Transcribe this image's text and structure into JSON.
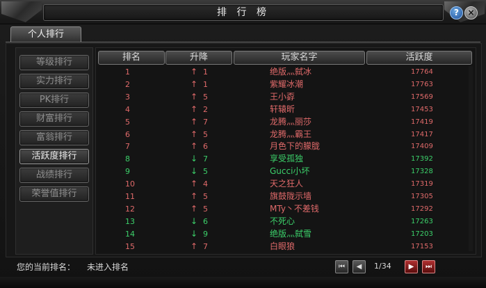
{
  "window": {
    "title": "排 行 榜"
  },
  "tab": {
    "label": "个人排行"
  },
  "categories": [
    {
      "label": "等级排行"
    },
    {
      "label": "实力排行"
    },
    {
      "label": "PK排行"
    },
    {
      "label": "财富排行"
    },
    {
      "label": "富翁排行"
    },
    {
      "label": "活跃度排行"
    },
    {
      "label": "战绩排行"
    },
    {
      "label": "荣誉值排行"
    }
  ],
  "active_category": "活跃度排行",
  "table": {
    "headers": {
      "rank": "排名",
      "change": "升降",
      "name": "玩家名字",
      "activity": "活跃度"
    },
    "rows": [
      {
        "rank": "1",
        "dir": "up",
        "arrow": "↑",
        "change": "1",
        "name": "绝版灬弑冰",
        "activity": "17764"
      },
      {
        "rank": "2",
        "dir": "up",
        "arrow": "↑",
        "change": "1",
        "name": "紫耀冰潮",
        "activity": "17763"
      },
      {
        "rank": "3",
        "dir": "up",
        "arrow": "↑",
        "change": "5",
        "name": "王小孬",
        "activity": "17569"
      },
      {
        "rank": "4",
        "dir": "up",
        "arrow": "↑",
        "change": "2",
        "name": "轩辕昕",
        "activity": "17453"
      },
      {
        "rank": "5",
        "dir": "up",
        "arrow": "↑",
        "change": "7",
        "name": "龙腾灬丽莎",
        "activity": "17419"
      },
      {
        "rank": "6",
        "dir": "up",
        "arrow": "↑",
        "change": "5",
        "name": "龙腾灬霸王",
        "activity": "17417"
      },
      {
        "rank": "7",
        "dir": "up",
        "arrow": "↑",
        "change": "6",
        "name": "月色下的朦胧",
        "activity": "17409"
      },
      {
        "rank": "8",
        "dir": "down",
        "arrow": "↓",
        "change": "7",
        "name": "享受孤独",
        "activity": "17392"
      },
      {
        "rank": "9",
        "dir": "down",
        "arrow": "↓",
        "change": "5",
        "name": "Gucci小坏",
        "activity": "17328"
      },
      {
        "rank": "10",
        "dir": "up",
        "arrow": "↑",
        "change": "4",
        "name": "天之狂人",
        "activity": "17319"
      },
      {
        "rank": "11",
        "dir": "up",
        "arrow": "↑",
        "change": "5",
        "name": "旗鼓陇示墙",
        "activity": "17305"
      },
      {
        "rank": "12",
        "dir": "up",
        "arrow": "↑",
        "change": "5",
        "name": "MTy丶不差钱",
        "activity": "17292"
      },
      {
        "rank": "13",
        "dir": "down",
        "arrow": "↓",
        "change": "6",
        "name": "不死心",
        "activity": "17263"
      },
      {
        "rank": "14",
        "dir": "down",
        "arrow": "↓",
        "change": "9",
        "name": "绝版灬弑雪",
        "activity": "17203"
      },
      {
        "rank": "15",
        "dir": "up",
        "arrow": "↑",
        "change": "7",
        "name": "白眼狼",
        "activity": "17153"
      }
    ]
  },
  "footer": {
    "label": "您的当前排名：",
    "value": "未进入排名",
    "page": "1/34"
  },
  "icons": {
    "help": "?",
    "close": "×",
    "first": "⏮",
    "prev": "◀",
    "next": "▶",
    "last": "⏭"
  },
  "colors": {
    "up": "#e06a6a",
    "down": "#3cd06a"
  }
}
